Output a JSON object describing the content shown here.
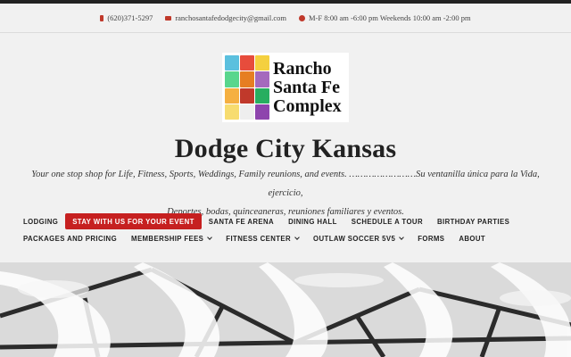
{
  "contact": {
    "phone": "(620)371-5297",
    "email": "ranchosantafedodgecity@gmail.com",
    "hours": "M-F 8:00 am -6:00 pm Weekends 10:00 am -2:00 pm"
  },
  "logo": {
    "line1": "Rancho",
    "line2": "Santa Fe",
    "line3": "Complex"
  },
  "site": {
    "title": "Dodge City Kansas",
    "tagline_line1": "Your one stop shop for Life, Fitness, Sports, Weddings, Family reunions, and events. ……………………Su ventanilla única para la Vida, ejercicio,",
    "tagline_line2": "Deportes, bodas, quinceaneras, reuniones familiares y eventos."
  },
  "nav": {
    "row1": [
      "LODGING",
      "STAY WITH US FOR YOUR EVENT",
      "SANTA FE ARENA",
      "DINING HALL",
      "SCHEDULE A TOUR",
      "BIRTHDAY PARTIES"
    ],
    "row2": [
      "PACKAGES AND PRICING",
      "MEMBERSHIP FEES",
      "FITNESS CENTER",
      "OUTLAW SOCCER 5V5",
      "FORMS",
      "ABOUT"
    ],
    "active": "STAY WITH US FOR YOUR EVENT"
  },
  "colors": {
    "accent": "#c62020",
    "icon": "#c0392b"
  },
  "icons": {
    "phone": "phone-icon",
    "email": "envelope-icon",
    "hours": "clock-icon",
    "dropdown": "chevron-down-icon"
  }
}
